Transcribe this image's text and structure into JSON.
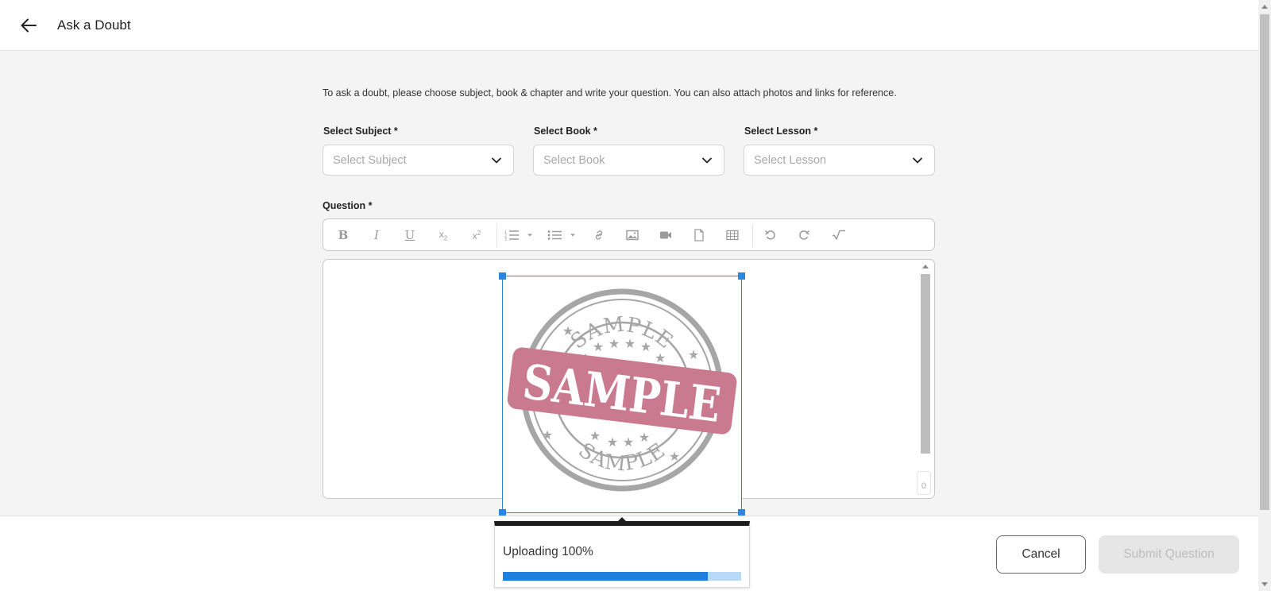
{
  "header": {
    "title": "Ask a Doubt",
    "back_icon": "arrow-left-icon"
  },
  "intro_text": "To ask a doubt, please choose subject, book & chapter and write your question. You can also attach photos and links for reference.",
  "selects": [
    {
      "label": "Select Subject *",
      "placeholder": "Select Subject"
    },
    {
      "label": "Select Book *",
      "placeholder": "Select Book"
    },
    {
      "label": "Select Lesson *",
      "placeholder": "Select Lesson"
    }
  ],
  "question": {
    "label": "Question *",
    "toolbar": [
      "bold-icon",
      "italic-icon",
      "underline-icon",
      "subscript-icon",
      "superscript-icon",
      "ordered-list-icon",
      "unordered-list-icon",
      "link-icon",
      "image-icon",
      "video-icon",
      "file-icon",
      "table-icon",
      "undo-icon",
      "redo-icon",
      "math-formula-icon"
    ],
    "char_count": "0",
    "image": {
      "top_text": "SAMPLE",
      "center_text": "SAMPLE",
      "bottom_text": "SAMPLE"
    }
  },
  "upload": {
    "text": "Uploading 100%",
    "progress": 0.86
  },
  "footer": {
    "cancel_label": "Cancel",
    "submit_label": "Submit Question"
  },
  "colors": {
    "accent": "#1e7fdc",
    "stamp_pink": "#c97a8f",
    "stamp_gray": "#a6a6a6"
  }
}
